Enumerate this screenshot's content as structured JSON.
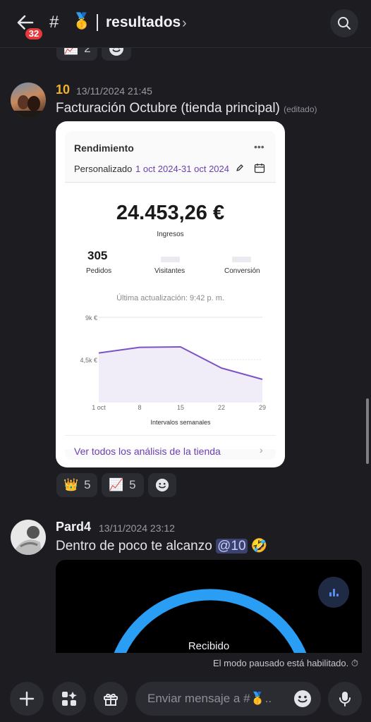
{
  "header": {
    "back_badge": "32",
    "hash": "#",
    "channel_emoji": "🥇",
    "channel_name": "resultados",
    "channel_chevron": "›"
  },
  "top_reactions": [
    {
      "emoji": "📈",
      "count": "2"
    },
    {
      "emoji": "🙂",
      "count": ""
    }
  ],
  "messages": [
    {
      "author": "10",
      "author_color": "#f0b232",
      "timestamp": "13/11/2024 21:45",
      "text": "Facturación Octubre (tienda principal)",
      "edited": "(editado)",
      "embed": {
        "title": "Rendimiento",
        "menu": "•••",
        "period_label": "Personalizado",
        "period_range": "1 oct 2024-31 oct 2024",
        "amount": "24.453,26 €",
        "amount_label": "Ingresos",
        "metrics": [
          {
            "value": "305",
            "label": "Pedidos"
          },
          {
            "value": "",
            "label": "Visitantes"
          },
          {
            "value": "",
            "label": "Conversión"
          }
        ],
        "last_update": "Última actualización: 9:42 p. m.",
        "link": "Ver todos los análisis de la tienda",
        "link_chevron": "›"
      },
      "reactions": [
        {
          "emoji": "👑",
          "count": "5"
        },
        {
          "emoji": "📈",
          "count": "5"
        },
        {
          "emoji": "🙂",
          "count": ""
        }
      ]
    },
    {
      "author": "Pard4",
      "author_color": "#f2f3f5",
      "timestamp": "13/11/2024 23:12",
      "text": "Dentro de poco te alcanzo",
      "mention": "@10",
      "trailing_emoji": "🤣",
      "embed_text": "Recibido"
    }
  ],
  "paused_notice": "El modo pausado está habilitado. ⏱",
  "composer": {
    "placeholder": "Enviar mensaje a #🥇.."
  },
  "chart_data": {
    "type": "area",
    "title": "",
    "x": [
      "1 oct",
      "8",
      "15",
      "22",
      "29"
    ],
    "values": [
      5.2,
      5.8,
      5.85,
      3.6,
      2.4
    ],
    "y_ticks": [
      "9k €",
      "4,5k €"
    ],
    "ylim": [
      0,
      9
    ],
    "xlabel": "Intervalos semanales",
    "ylabel": "",
    "grid": true,
    "line_color": "#7b52c7"
  }
}
